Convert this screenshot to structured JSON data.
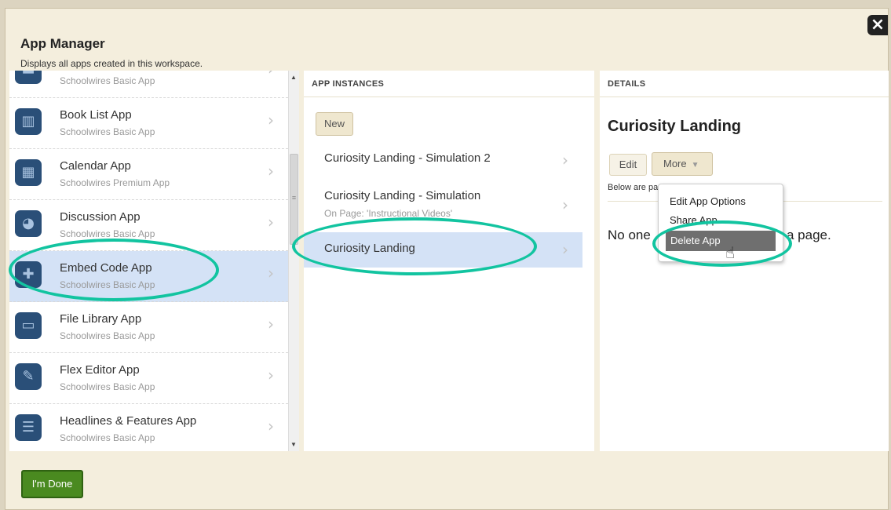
{
  "modal": {
    "title": "App Manager",
    "subtitle": "Displays all apps created in this workspace.",
    "close_glyph": "×",
    "done_label": "I'm Done"
  },
  "apps": {
    "items": [
      {
        "name": "",
        "type": "Schoolwires Basic App",
        "icon": "generic-app-icon",
        "glyph": "▬",
        "selected": false
      },
      {
        "name": "Book List App",
        "type": "Schoolwires Basic App",
        "icon": "book-icon",
        "glyph": "▥",
        "selected": false
      },
      {
        "name": "Calendar App",
        "type": "Schoolwires Premium App",
        "icon": "calendar-icon",
        "glyph": "▦",
        "selected": false
      },
      {
        "name": "Discussion App",
        "type": "Schoolwires Basic App",
        "icon": "chat-bubbles-icon",
        "glyph": "◕",
        "selected": false
      },
      {
        "name": "Embed Code App",
        "type": "Schoolwires Basic App",
        "icon": "puzzle-icon",
        "glyph": "✚",
        "selected": true
      },
      {
        "name": "File Library App",
        "type": "Schoolwires Basic App",
        "icon": "folder-icon",
        "glyph": "▭",
        "selected": false
      },
      {
        "name": "Flex Editor App",
        "type": "Schoolwires Basic App",
        "icon": "edit-pencil-icon",
        "glyph": "✎",
        "selected": false
      },
      {
        "name": "Headlines & Features App",
        "type": "Schoolwires Basic App",
        "icon": "list-icon",
        "glyph": "☰",
        "selected": false
      }
    ],
    "chevron": "›"
  },
  "scrollbar": {
    "up": "▲",
    "down": "▼",
    "grip": "≡"
  },
  "instances": {
    "header": "APP INSTANCES",
    "new_label": "New",
    "items": [
      {
        "name": "Curiosity Landing - Simulation 2",
        "sub": "",
        "selected": false
      },
      {
        "name": "Curiosity Landing - Simulation",
        "sub": "On Page: 'Instructional Videos'",
        "selected": false
      },
      {
        "name": "Curiosity Landing",
        "sub": "",
        "selected": true
      }
    ]
  },
  "details": {
    "header": "DETAILS",
    "title": "Curiosity Landing",
    "edit_label": "Edit",
    "more_label": "More",
    "more_caret": "▼",
    "below_text": "Below are pages that use this App.",
    "no_one_text_start": "No one",
    "no_one_text_end": "a page."
  },
  "dropdown": {
    "items": [
      "Edit App Options",
      "Share App",
      "Delete App"
    ],
    "cursor_glyph": "☝"
  },
  "colors": {
    "highlight_ring": "#12c4a0",
    "selected_row": "#d4e2f6",
    "done_button": "#4a8a20",
    "app_icon_bg": "#2a4f78"
  }
}
